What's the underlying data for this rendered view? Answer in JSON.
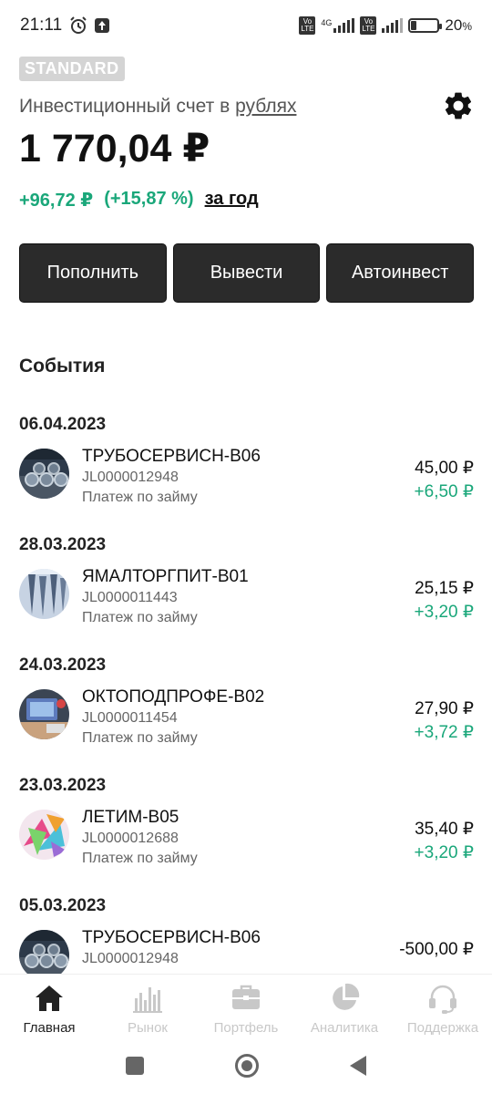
{
  "status_bar": {
    "time": "21:11",
    "network": "4G",
    "battery": "20",
    "battery_unit": "%",
    "battery_level": 0.2
  },
  "account": {
    "plan": "STANDARD",
    "label_prefix": "Инвестиционный счет в ",
    "label_link": "рублях",
    "balance": "1 770,04 ₽",
    "gain_abs": "+96,72 ₽",
    "gain_pct": "(+15,87 %)",
    "period": "за год"
  },
  "actions": {
    "deposit": "Пополнить",
    "withdraw": "Вывести",
    "autoinvest": "Автоинвест"
  },
  "events": {
    "title": "События",
    "groups": [
      {
        "date": "06.04.2023",
        "name": "ТРУБОСЕРВИСН-В06",
        "code": "JL0000012948",
        "desc": "Платеж по займу",
        "amount": "45,00 ₽",
        "income": "+6,50 ₽",
        "avatar": "pipes"
      },
      {
        "date": "28.03.2023",
        "name": "ЯМАЛТОРГПИТ-В01",
        "code": "JL0000011443",
        "desc": "Платеж по займу",
        "amount": "25,15 ₽",
        "income": "+3,20 ₽",
        "avatar": "fish"
      },
      {
        "date": "24.03.2023",
        "name": "ОКТОПОДПРОФЕ-В02",
        "code": "JL0000011454",
        "desc": "Платеж по займу",
        "amount": "27,90 ₽",
        "income": "+3,72 ₽",
        "avatar": "office"
      },
      {
        "date": "23.03.2023",
        "name": "ЛЕТИМ-В05",
        "code": "JL0000012688",
        "desc": "Платеж по займу",
        "amount": "35,40 ₽",
        "income": "+3,20 ₽",
        "avatar": "colorful"
      },
      {
        "date": "05.03.2023",
        "name": "ТРУБОСЕРВИСН-В06",
        "code": "JL0000012948",
        "desc": "",
        "amount": "-500,00 ₽",
        "income": "",
        "avatar": "pipes"
      }
    ]
  },
  "bottom_nav": {
    "items": [
      {
        "label": "Главная",
        "icon": "home-icon",
        "active": true
      },
      {
        "label": "Рынок",
        "icon": "bar-chart-icon",
        "active": false
      },
      {
        "label": "Портфель",
        "icon": "briefcase-icon",
        "active": false
      },
      {
        "label": "Аналитика",
        "icon": "pie-chart-icon",
        "active": false
      },
      {
        "label": "Поддержка",
        "icon": "headset-icon",
        "active": false
      }
    ]
  },
  "colors": {
    "accent_green": "#1aa77a",
    "button_dark": "#2b2b2b",
    "badge_gray": "#d4d4d4"
  }
}
